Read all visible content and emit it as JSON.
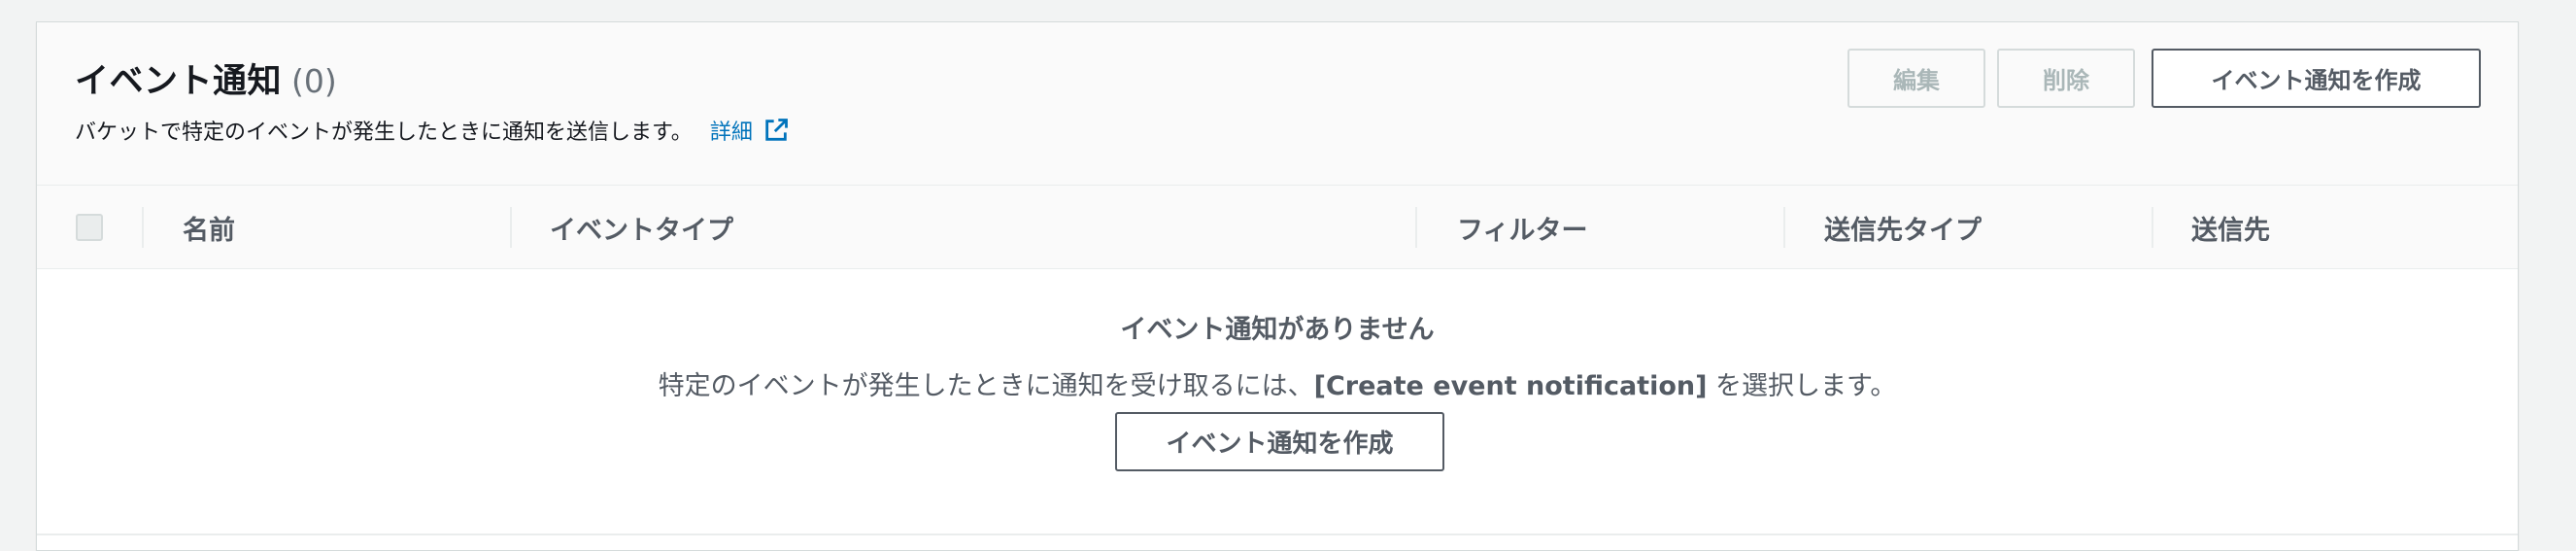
{
  "panel": {
    "title": "イベント通知",
    "count": "(0)",
    "description": "バケットで特定のイベントが発生したときに通知を送信します。",
    "info_link": "詳細",
    "buttons": {
      "edit": "編集",
      "delete": "削除",
      "create": "イベント通知を作成"
    }
  },
  "table": {
    "columns": [
      "名前",
      "イベントタイプ",
      "フィルター",
      "送信先タイプ",
      "送信先"
    ],
    "empty": {
      "title": "イベント通知がありません",
      "desc_prefix": "特定のイベントが発生したときに通知を受け取るには、",
      "desc_bold": "[Create event notification]",
      "desc_suffix": " を選択します。",
      "button": "イベント通知を作成"
    }
  },
  "icons": {
    "info_link": "external-link-icon"
  },
  "colors": {
    "link": "#0073bb",
    "text": "#16191f",
    "muted": "#545b64",
    "disabled": "#aab7b8",
    "border": "#eaeded",
    "page_bg": "#f2f3f3"
  }
}
